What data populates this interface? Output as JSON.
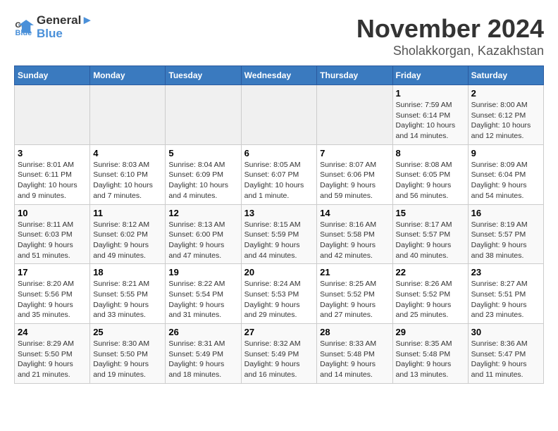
{
  "header": {
    "logo_line1": "General",
    "logo_line2": "Blue",
    "month": "November 2024",
    "location": "Sholakkorgan, Kazakhstan"
  },
  "weekdays": [
    "Sunday",
    "Monday",
    "Tuesday",
    "Wednesday",
    "Thursday",
    "Friday",
    "Saturday"
  ],
  "weeks": [
    [
      {
        "day": "",
        "sunrise": "",
        "sunset": "",
        "daylight": ""
      },
      {
        "day": "",
        "sunrise": "",
        "sunset": "",
        "daylight": ""
      },
      {
        "day": "",
        "sunrise": "",
        "sunset": "",
        "daylight": ""
      },
      {
        "day": "",
        "sunrise": "",
        "sunset": "",
        "daylight": ""
      },
      {
        "day": "",
        "sunrise": "",
        "sunset": "",
        "daylight": ""
      },
      {
        "day": "1",
        "sunrise": "Sunrise: 7:59 AM",
        "sunset": "Sunset: 6:14 PM",
        "daylight": "Daylight: 10 hours and 14 minutes."
      },
      {
        "day": "2",
        "sunrise": "Sunrise: 8:00 AM",
        "sunset": "Sunset: 6:12 PM",
        "daylight": "Daylight: 10 hours and 12 minutes."
      }
    ],
    [
      {
        "day": "3",
        "sunrise": "Sunrise: 8:01 AM",
        "sunset": "Sunset: 6:11 PM",
        "daylight": "Daylight: 10 hours and 9 minutes."
      },
      {
        "day": "4",
        "sunrise": "Sunrise: 8:03 AM",
        "sunset": "Sunset: 6:10 PM",
        "daylight": "Daylight: 10 hours and 7 minutes."
      },
      {
        "day": "5",
        "sunrise": "Sunrise: 8:04 AM",
        "sunset": "Sunset: 6:09 PM",
        "daylight": "Daylight: 10 hours and 4 minutes."
      },
      {
        "day": "6",
        "sunrise": "Sunrise: 8:05 AM",
        "sunset": "Sunset: 6:07 PM",
        "daylight": "Daylight: 10 hours and 1 minute."
      },
      {
        "day": "7",
        "sunrise": "Sunrise: 8:07 AM",
        "sunset": "Sunset: 6:06 PM",
        "daylight": "Daylight: 9 hours and 59 minutes."
      },
      {
        "day": "8",
        "sunrise": "Sunrise: 8:08 AM",
        "sunset": "Sunset: 6:05 PM",
        "daylight": "Daylight: 9 hours and 56 minutes."
      },
      {
        "day": "9",
        "sunrise": "Sunrise: 8:09 AM",
        "sunset": "Sunset: 6:04 PM",
        "daylight": "Daylight: 9 hours and 54 minutes."
      }
    ],
    [
      {
        "day": "10",
        "sunrise": "Sunrise: 8:11 AM",
        "sunset": "Sunset: 6:03 PM",
        "daylight": "Daylight: 9 hours and 51 minutes."
      },
      {
        "day": "11",
        "sunrise": "Sunrise: 8:12 AM",
        "sunset": "Sunset: 6:02 PM",
        "daylight": "Daylight: 9 hours and 49 minutes."
      },
      {
        "day": "12",
        "sunrise": "Sunrise: 8:13 AM",
        "sunset": "Sunset: 6:00 PM",
        "daylight": "Daylight: 9 hours and 47 minutes."
      },
      {
        "day": "13",
        "sunrise": "Sunrise: 8:15 AM",
        "sunset": "Sunset: 5:59 PM",
        "daylight": "Daylight: 9 hours and 44 minutes."
      },
      {
        "day": "14",
        "sunrise": "Sunrise: 8:16 AM",
        "sunset": "Sunset: 5:58 PM",
        "daylight": "Daylight: 9 hours and 42 minutes."
      },
      {
        "day": "15",
        "sunrise": "Sunrise: 8:17 AM",
        "sunset": "Sunset: 5:57 PM",
        "daylight": "Daylight: 9 hours and 40 minutes."
      },
      {
        "day": "16",
        "sunrise": "Sunrise: 8:19 AM",
        "sunset": "Sunset: 5:57 PM",
        "daylight": "Daylight: 9 hours and 38 minutes."
      }
    ],
    [
      {
        "day": "17",
        "sunrise": "Sunrise: 8:20 AM",
        "sunset": "Sunset: 5:56 PM",
        "daylight": "Daylight: 9 hours and 35 minutes."
      },
      {
        "day": "18",
        "sunrise": "Sunrise: 8:21 AM",
        "sunset": "Sunset: 5:55 PM",
        "daylight": "Daylight: 9 hours and 33 minutes."
      },
      {
        "day": "19",
        "sunrise": "Sunrise: 8:22 AM",
        "sunset": "Sunset: 5:54 PM",
        "daylight": "Daylight: 9 hours and 31 minutes."
      },
      {
        "day": "20",
        "sunrise": "Sunrise: 8:24 AM",
        "sunset": "Sunset: 5:53 PM",
        "daylight": "Daylight: 9 hours and 29 minutes."
      },
      {
        "day": "21",
        "sunrise": "Sunrise: 8:25 AM",
        "sunset": "Sunset: 5:52 PM",
        "daylight": "Daylight: 9 hours and 27 minutes."
      },
      {
        "day": "22",
        "sunrise": "Sunrise: 8:26 AM",
        "sunset": "Sunset: 5:52 PM",
        "daylight": "Daylight: 9 hours and 25 minutes."
      },
      {
        "day": "23",
        "sunrise": "Sunrise: 8:27 AM",
        "sunset": "Sunset: 5:51 PM",
        "daylight": "Daylight: 9 hours and 23 minutes."
      }
    ],
    [
      {
        "day": "24",
        "sunrise": "Sunrise: 8:29 AM",
        "sunset": "Sunset: 5:50 PM",
        "daylight": "Daylight: 9 hours and 21 minutes."
      },
      {
        "day": "25",
        "sunrise": "Sunrise: 8:30 AM",
        "sunset": "Sunset: 5:50 PM",
        "daylight": "Daylight: 9 hours and 19 minutes."
      },
      {
        "day": "26",
        "sunrise": "Sunrise: 8:31 AM",
        "sunset": "Sunset: 5:49 PM",
        "daylight": "Daylight: 9 hours and 18 minutes."
      },
      {
        "day": "27",
        "sunrise": "Sunrise: 8:32 AM",
        "sunset": "Sunset: 5:49 PM",
        "daylight": "Daylight: 9 hours and 16 minutes."
      },
      {
        "day": "28",
        "sunrise": "Sunrise: 8:33 AM",
        "sunset": "Sunset: 5:48 PM",
        "daylight": "Daylight: 9 hours and 14 minutes."
      },
      {
        "day": "29",
        "sunrise": "Sunrise: 8:35 AM",
        "sunset": "Sunset: 5:48 PM",
        "daylight": "Daylight: 9 hours and 13 minutes."
      },
      {
        "day": "30",
        "sunrise": "Sunrise: 8:36 AM",
        "sunset": "Sunset: 5:47 PM",
        "daylight": "Daylight: 9 hours and 11 minutes."
      }
    ]
  ]
}
